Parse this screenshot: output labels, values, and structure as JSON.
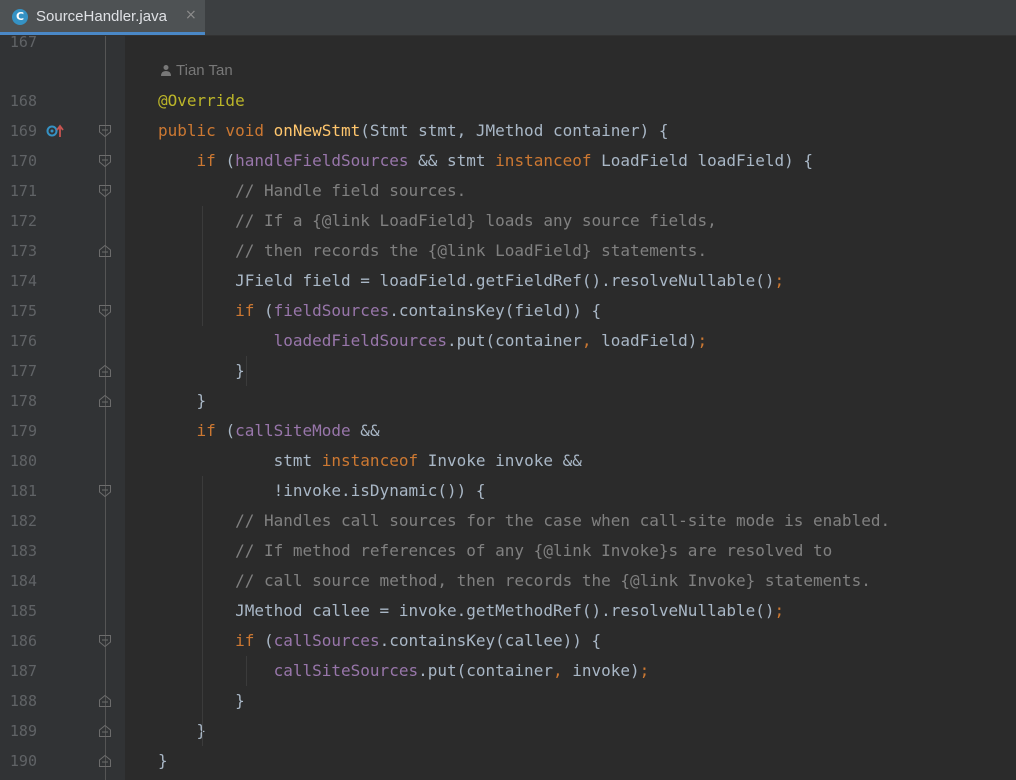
{
  "tab": {
    "title": "SourceHandler.java",
    "icon": "C",
    "close": "×"
  },
  "author": "Tian Tan",
  "lines": [
    {
      "n": "167",
      "segs": []
    },
    {
      "n": "168",
      "segs": [
        [
          "ann",
          "@Override"
        ]
      ]
    },
    {
      "n": "169",
      "segs": [
        [
          "kw",
          "public void "
        ],
        [
          "fn",
          "onNewStmt"
        ],
        [
          "",
          "(Stmt stmt, JMethod container) {"
        ]
      ]
    },
    {
      "n": "170",
      "segs": [
        [
          "",
          "    "
        ],
        [
          "kw",
          "if "
        ],
        [
          "",
          "("
        ],
        [
          "fld",
          "handleFieldSources"
        ],
        [
          "",
          " && stmt "
        ],
        [
          "kw",
          "instanceof "
        ],
        [
          "",
          "LoadField loadField) {"
        ]
      ]
    },
    {
      "n": "171",
      "segs": [
        [
          "",
          "        "
        ],
        [
          "cm",
          "// Handle field sources."
        ]
      ]
    },
    {
      "n": "172",
      "segs": [
        [
          "",
          "        "
        ],
        [
          "cm",
          "// If a {@link LoadField} loads any source fields,"
        ]
      ]
    },
    {
      "n": "173",
      "segs": [
        [
          "",
          "        "
        ],
        [
          "cm",
          "// then records the {@link LoadField} statements."
        ]
      ]
    },
    {
      "n": "174",
      "segs": [
        [
          "",
          "        JField field = loadField.getFieldRef().resolveNullable()"
        ],
        [
          "kw",
          ";"
        ]
      ]
    },
    {
      "n": "175",
      "segs": [
        [
          "",
          "        "
        ],
        [
          "kw",
          "if "
        ],
        [
          "",
          "("
        ],
        [
          "fld",
          "fieldSources"
        ],
        [
          "",
          ".containsKey(field)) {"
        ]
      ]
    },
    {
      "n": "176",
      "segs": [
        [
          "",
          "            "
        ],
        [
          "fld",
          "loadedFieldSources"
        ],
        [
          "",
          ".put(container"
        ],
        [
          "kw",
          ", "
        ],
        [
          "",
          "loadField)"
        ],
        [
          "kw",
          ";"
        ]
      ]
    },
    {
      "n": "177",
      "segs": [
        [
          "",
          "        }"
        ]
      ]
    },
    {
      "n": "178",
      "segs": [
        [
          "",
          "    }"
        ]
      ]
    },
    {
      "n": "179",
      "segs": [
        [
          "",
          "    "
        ],
        [
          "kw",
          "if "
        ],
        [
          "",
          "("
        ],
        [
          "fld",
          "callSiteMode"
        ],
        [
          "",
          " &&"
        ]
      ]
    },
    {
      "n": "180",
      "segs": [
        [
          "",
          "            stmt "
        ],
        [
          "kw",
          "instanceof "
        ],
        [
          "",
          "Invoke invoke &&"
        ]
      ]
    },
    {
      "n": "181",
      "segs": [
        [
          "",
          "            !invoke.isDynamic()) {"
        ]
      ]
    },
    {
      "n": "182",
      "segs": [
        [
          "",
          "        "
        ],
        [
          "cm",
          "// Handles call sources for the case when call-site mode is enabled."
        ]
      ]
    },
    {
      "n": "183",
      "segs": [
        [
          "",
          "        "
        ],
        [
          "cm",
          "// If method references of any {@link Invoke}s are resolved to"
        ]
      ]
    },
    {
      "n": "184",
      "segs": [
        [
          "",
          "        "
        ],
        [
          "cm",
          "// call source method, then records the {@link Invoke} statements."
        ]
      ]
    },
    {
      "n": "185",
      "segs": [
        [
          "",
          "        JMethod callee = invoke.getMethodRef().resolveNullable()"
        ],
        [
          "kw",
          ";"
        ]
      ]
    },
    {
      "n": "186",
      "segs": [
        [
          "",
          "        "
        ],
        [
          "kw",
          "if "
        ],
        [
          "",
          "("
        ],
        [
          "fld",
          "callSources"
        ],
        [
          "",
          ".containsKey(callee)) {"
        ]
      ]
    },
    {
      "n": "187",
      "segs": [
        [
          "",
          "            "
        ],
        [
          "fld",
          "callSiteSources"
        ],
        [
          "",
          ".put(container"
        ],
        [
          "kw",
          ", "
        ],
        [
          "",
          "invoke)"
        ],
        [
          "kw",
          ";"
        ]
      ]
    },
    {
      "n": "188",
      "segs": [
        [
          "",
          "        }"
        ]
      ]
    },
    {
      "n": "189",
      "segs": [
        [
          "",
          "    }"
        ]
      ]
    },
    {
      "n": "190",
      "segs": [
        [
          "",
          "}"
        ]
      ]
    }
  ],
  "folds": {
    "open": [
      "169",
      "170",
      "171",
      "175",
      "181",
      "186"
    ],
    "close": [
      "173",
      "177",
      "178",
      "188",
      "189",
      "190"
    ]
  },
  "colors": {
    "keyword": "#cc7832",
    "annotation": "#bbb529",
    "method": "#ffc66d",
    "field": "#9876aa",
    "comment": "#808080",
    "text": "#a9b7c6"
  }
}
